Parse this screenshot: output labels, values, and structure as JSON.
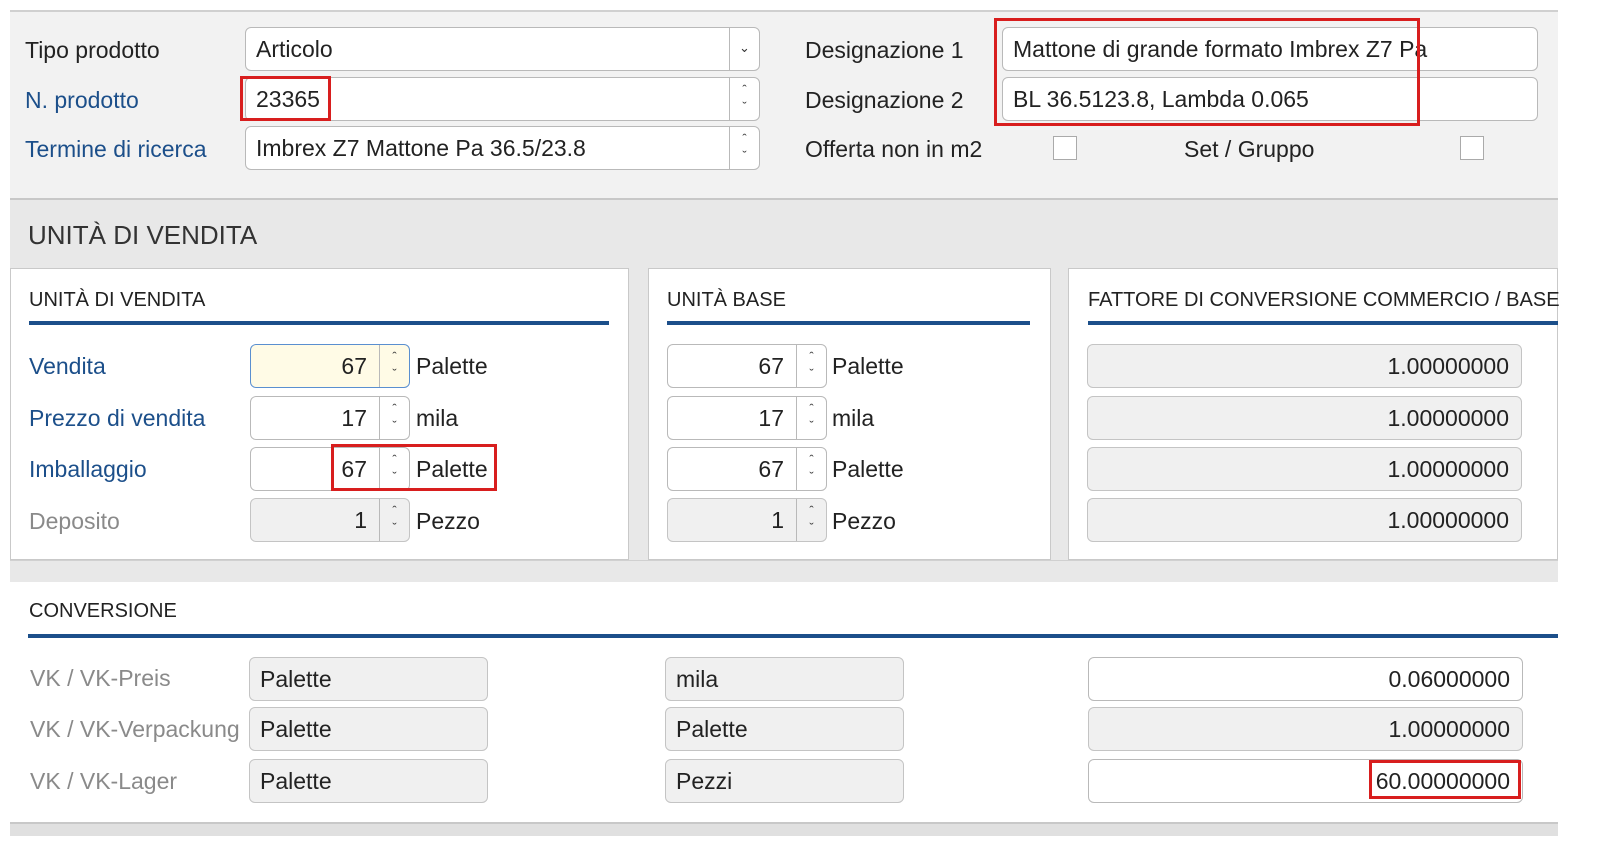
{
  "header": {
    "tipo_prodotto_label": "Tipo prodotto",
    "tipo_prodotto_value": "Articolo",
    "n_prodotto_label": "N. prodotto",
    "n_prodotto_value": "23365",
    "termine_label": "Termine di ricerca",
    "termine_value": "Imbrex Z7 Mattone Pa 36.5/23.8",
    "designazione1_label": "Designazione 1",
    "designazione1_value": "Mattone di grande formato Imbrex Z7 Pa",
    "designazione2_label": "Designazione 2",
    "designazione2_value": "BL 36.5123.8, Lambda 0.065",
    "offerta_label": "Offerta non in m2",
    "set_gruppo_label": "Set / Gruppo"
  },
  "section": {
    "title": "UNITÀ DI VENDITA"
  },
  "unita_vendita": {
    "title": "UNITÀ DI VENDITA",
    "rows": [
      {
        "label": "Vendita",
        "value": "67",
        "unit": "Palette"
      },
      {
        "label": "Prezzo di vendita",
        "value": "17",
        "unit": "mila"
      },
      {
        "label": "Imballaggio",
        "value": "67",
        "unit": "Palette"
      },
      {
        "label": "Deposito",
        "value": "1",
        "unit": "Pezzo"
      }
    ]
  },
  "unita_base": {
    "title": "UNITÀ BASE",
    "rows": [
      {
        "value": "67",
        "unit": "Palette"
      },
      {
        "value": "17",
        "unit": "mila"
      },
      {
        "value": "67",
        "unit": "Palette"
      },
      {
        "value": "1",
        "unit": "Pezzo"
      }
    ]
  },
  "fattore": {
    "title": "FATTORE DI CONVERSIONE COMMERCIO / BASE",
    "values": [
      "1.00000000",
      "1.00000000",
      "1.00000000",
      "1.00000000"
    ]
  },
  "conversione": {
    "title": "CONVERSIONE",
    "rows": [
      {
        "label": "VK / VK-Preis",
        "from": "Palette",
        "to": "mila",
        "factor": "0.06000000"
      },
      {
        "label": "VK / VK-Verpackung",
        "from": "Palette",
        "to": "Palette",
        "factor": "1.00000000"
      },
      {
        "label": "VK / VK-Lager",
        "from": "Palette",
        "to": "Pezzi",
        "factor": "60.00000000"
      }
    ]
  },
  "icons": {
    "dropdown": "chevron-down-icon",
    "spinner": "spinner-up-down-icon"
  },
  "colors": {
    "label_blue": "#1c4f8a",
    "highlight_red": "#d81e1e",
    "section_bg": "#e8e8e8"
  }
}
